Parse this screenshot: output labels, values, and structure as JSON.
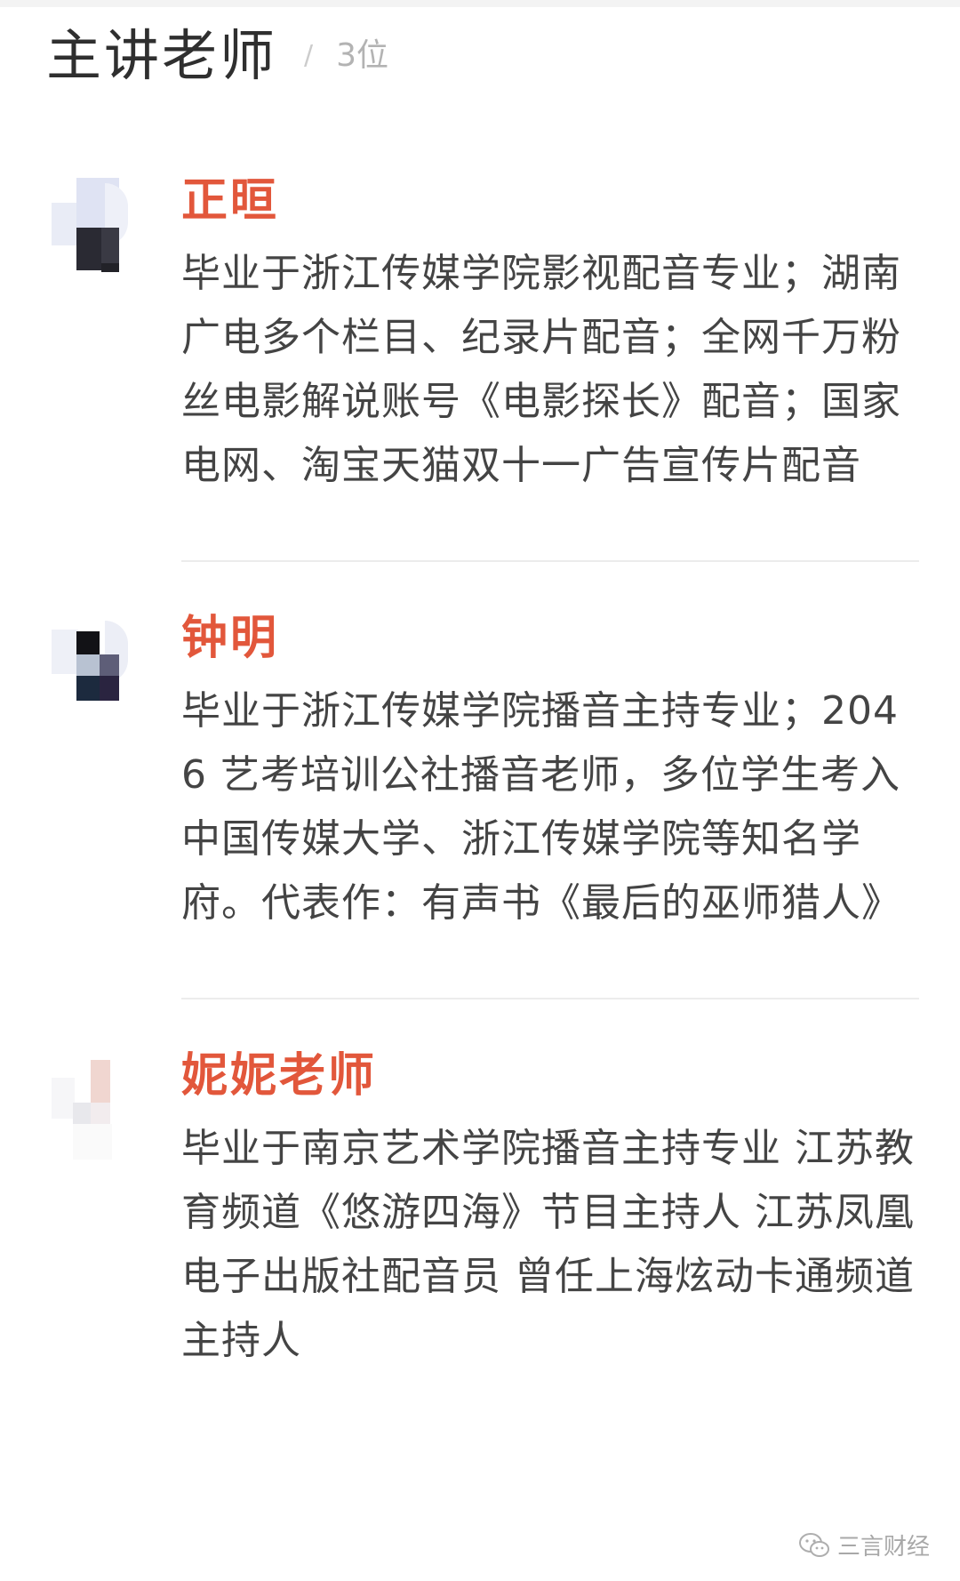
{
  "header": {
    "title": "主讲老师",
    "separator": "/",
    "count": "3位"
  },
  "teachers": [
    {
      "name": "正晅",
      "bio": "毕业于浙江传媒学院影视配音专业；湖南广电多个栏目、纪录片配音；全网千万粉丝电影解说账号《电影探长》配音；国家电网、淘宝天猫双十一广告宣传片配音"
    },
    {
      "name": "钟明",
      "bio": "毕业于浙江传媒学院播音主持专业；2046 艺考培训公社播音老师，多位学生考入中国传媒大学、浙江传媒学院等知名学府。代表作：有声书《最后的巫师猎人》"
    },
    {
      "name": "妮妮老师",
      "bio": "毕业于南京艺术学院播音主持专业 江苏教育频道《悠游四海》节目主持人 江苏凤凰电子出版社配音员 曾任上海炫动卡通频道主持人"
    }
  ],
  "watermark": {
    "text": "三言财经",
    "icon": "wechat-icon"
  },
  "colors": {
    "name": "#e2573b",
    "title": "#2f2f2f",
    "body": "#444444",
    "muted": "#b3b3b3",
    "divider": "#ececec"
  }
}
